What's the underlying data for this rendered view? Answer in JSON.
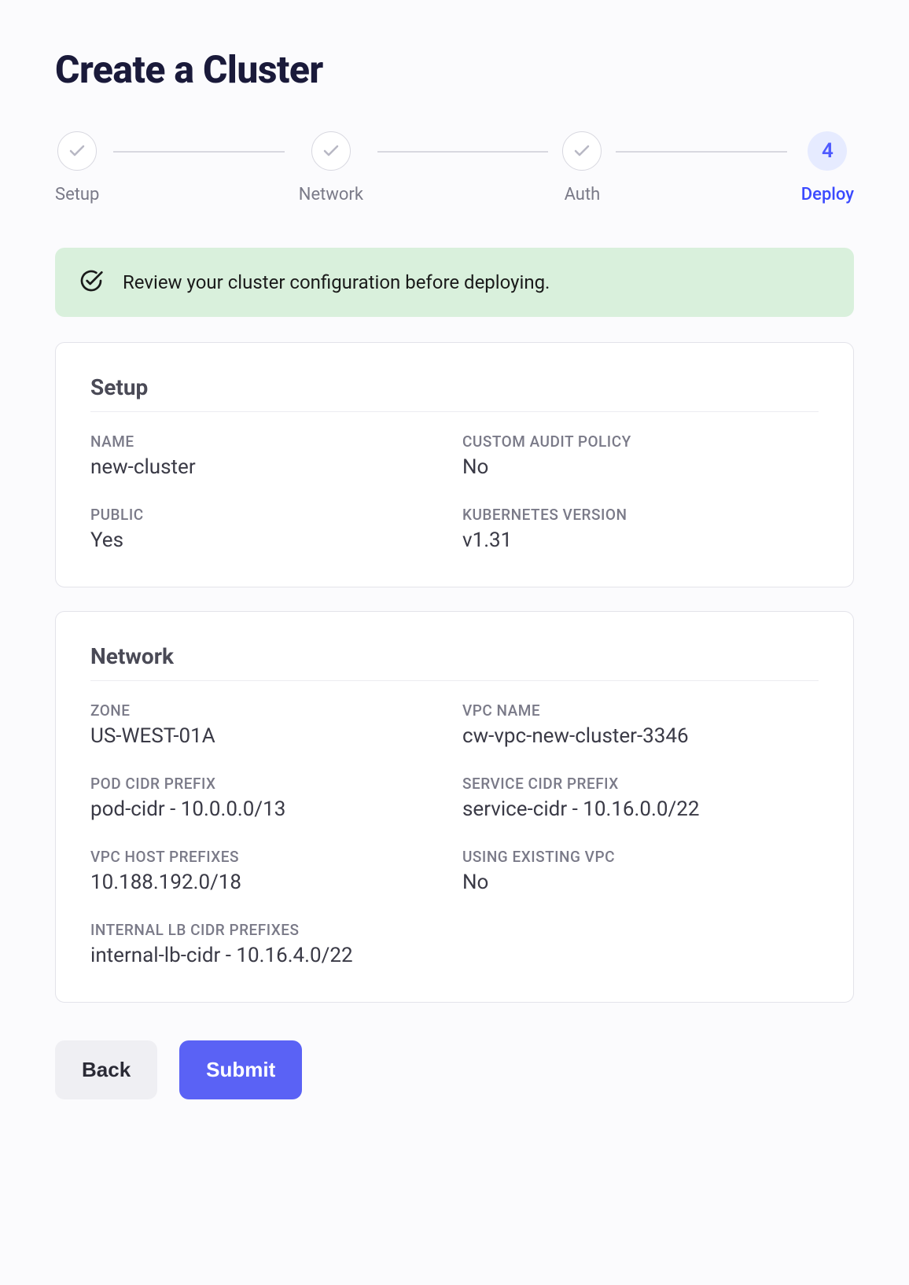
{
  "page_title": "Create a Cluster",
  "stepper": {
    "steps": [
      {
        "label": "Setup",
        "state": "done"
      },
      {
        "label": "Network",
        "state": "done"
      },
      {
        "label": "Auth",
        "state": "done"
      },
      {
        "label": "Deploy",
        "state": "active",
        "number": "4"
      }
    ]
  },
  "banner": {
    "text": "Review your cluster configuration before deploying."
  },
  "sections": {
    "setup": {
      "title": "Setup",
      "fields": {
        "name": {
          "label": "NAME",
          "value": "new-cluster"
        },
        "custom_audit_policy": {
          "label": "CUSTOM AUDIT POLICY",
          "value": "No"
        },
        "public": {
          "label": "PUBLIC",
          "value": "Yes"
        },
        "k8s_version": {
          "label": "KUBERNETES VERSION",
          "value": "v1.31"
        }
      }
    },
    "network": {
      "title": "Network",
      "fields": {
        "zone": {
          "label": "ZONE",
          "value": "US-WEST-01A"
        },
        "vpc_name": {
          "label": "VPC NAME",
          "value": "cw-vpc-new-cluster-3346"
        },
        "pod_cidr": {
          "label": "POD CIDR PREFIX",
          "value": "pod-cidr - 10.0.0.0/13"
        },
        "service_cidr": {
          "label": "SERVICE CIDR PREFIX",
          "value": "service-cidr - 10.16.0.0/22"
        },
        "vpc_host_prefixes": {
          "label": "VPC HOST PREFIXES",
          "value": "10.188.192.0/18"
        },
        "using_existing_vpc": {
          "label": "USING EXISTING VPC",
          "value": "No"
        },
        "internal_lb_cidr": {
          "label": "INTERNAL LB CIDR PREFIXES",
          "value": "internal-lb-cidr - 10.16.4.0/22"
        }
      }
    }
  },
  "actions": {
    "back": "Back",
    "submit": "Submit"
  }
}
